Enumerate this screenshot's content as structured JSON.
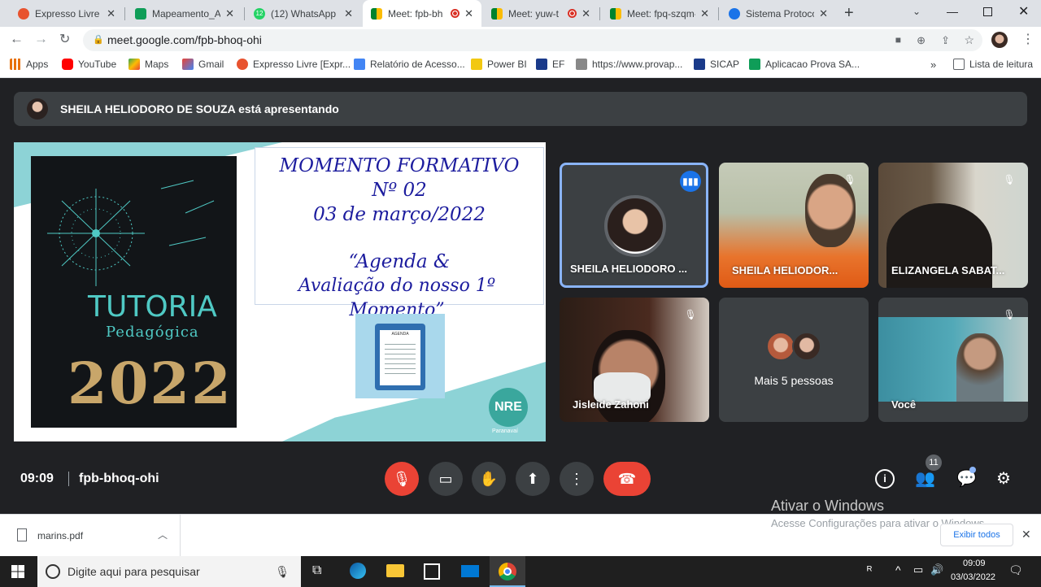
{
  "tabs": [
    {
      "title": "Expresso Livre [E",
      "color": "#e8532f"
    },
    {
      "title": "Mapeamento_Au",
      "color": "#0f9d58"
    },
    {
      "title": "(12) WhatsApp",
      "color": "#25d366"
    },
    {
      "title": "Meet: fpb-bh",
      "color": "#00897b"
    },
    {
      "title": "Meet: yuw-t",
      "color": "#00897b"
    },
    {
      "title": "Meet: fpq-szqm-",
      "color": "#00897b"
    },
    {
      "title": "Sistema Protocol",
      "color": "#1a73e8"
    }
  ],
  "whatsapp_badge": "12",
  "url": "meet.google.com/fpb-bhoq-ohi",
  "bookmarks": [
    "Apps",
    "YouTube",
    "Maps",
    "Gmail",
    "Expresso Livre [Expr...",
    "Relatório de Acesso...",
    "Power BI",
    "EF",
    "https://www.provap...",
    "SICAP",
    "Aplicacao Prova SA..."
  ],
  "reading_list": "Lista de leitura",
  "presenter_banner": "SHEILA HELIODORO DE SOUZA está apresentando",
  "slide": {
    "line1": "MOMENTO FORMATIVO",
    "line2": "Nº 02",
    "line3": "03 de março/2022",
    "line4": "“Agenda &",
    "line5": "Avaliação do nosso 1º Momento”",
    "tutoria": "TUTORIA",
    "pedagogica": "Pedagógica",
    "year": "2022",
    "clipboard_title": "AGENDA",
    "nre": "NRE",
    "nre_city": "Paranavaí"
  },
  "tiles": [
    {
      "name": "SHEILA HELIODORO ..."
    },
    {
      "name": "SHEILA HELIODOR..."
    },
    {
      "name": "ELIZANGELA SABAT..."
    },
    {
      "name": "Jisleide Zahoni"
    },
    {
      "name": "Mais 5 pessoas"
    },
    {
      "name": "Você"
    }
  ],
  "meeting_time": "09:09",
  "meeting_code": "fpb-bhoq-ohi",
  "people_count": "11",
  "watermark": {
    "title": "Ativar o Windows",
    "sub": "Acesse Configurações para ativar o Windows."
  },
  "download": {
    "file": "marins.pdf",
    "show_all": "Exibir todos"
  },
  "taskbar": {
    "search": "Digite aqui para pesquisar",
    "time": "09:09",
    "date": "03/03/2022"
  }
}
